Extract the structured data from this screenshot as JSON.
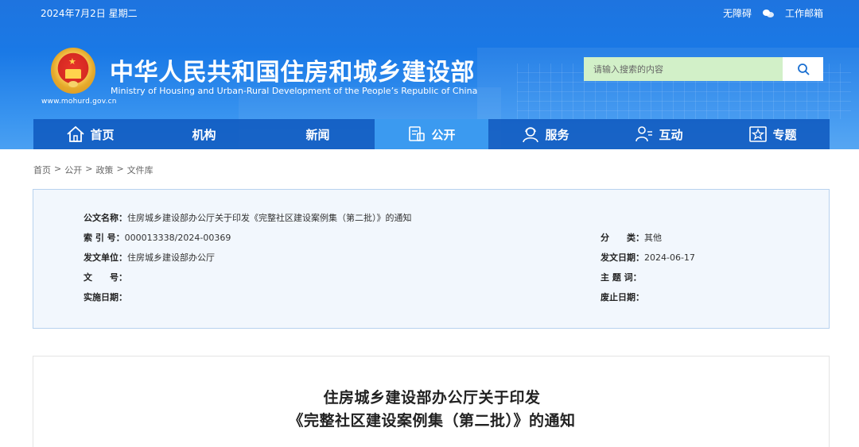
{
  "header": {
    "date": "2024年7月2日 星期二",
    "accessibility": "无障碍",
    "work_mail": "工作邮箱",
    "title_cn": "中华人民共和国住房和城乡建设部",
    "title_en": "Ministry of Housing and Urban-Rural Development of the People’s Republic of China",
    "site_url": "www.mohurd.gov.cn",
    "search_placeholder": "请输入搜索的内容"
  },
  "nav": {
    "items": [
      {
        "label": "首页",
        "icon": "home-icon"
      },
      {
        "label": "机构",
        "icon": ""
      },
      {
        "label": "新闻",
        "icon": ""
      },
      {
        "label": "公开",
        "icon": "document-icon"
      },
      {
        "label": "服务",
        "icon": "service-icon"
      },
      {
        "label": "互动",
        "icon": "interaction-icon"
      },
      {
        "label": "专题",
        "icon": "star-icon"
      }
    ],
    "active_index": 3
  },
  "breadcrumb": [
    "首页",
    "公开",
    "政策",
    "文件库"
  ],
  "meta": {
    "doc_name_label": "公文名称：",
    "doc_name": "住房城乡建设部办公厅关于印发《完整社区建设案例集（第二批）》的通知",
    "index_label": "索 引 号：",
    "index": "000013338/2024-00369",
    "category_label": "分　　类：",
    "category": "其他",
    "issuer_label": "发文单位：",
    "issuer": "住房城乡建设部办公厅",
    "issue_date_label": "发文日期：",
    "issue_date": "2024-06-17",
    "doc_no_label": "文　　号：",
    "doc_no": "",
    "subject_label": "主 题 词：",
    "subject": "",
    "effective_label": "实施日期：",
    "effective": "",
    "expire_label": "废止日期：",
    "expire": ""
  },
  "doc": {
    "title_line1": "住房城乡建设部办公厅关于印发",
    "title_line2": "《完整社区建设案例集（第二批）》的通知"
  },
  "colors": {
    "header_blue": "#1a79e6",
    "nav_active": "#3b9af0",
    "search_bg": "#d2f0c8",
    "meta_bg": "#f2f7fd"
  }
}
